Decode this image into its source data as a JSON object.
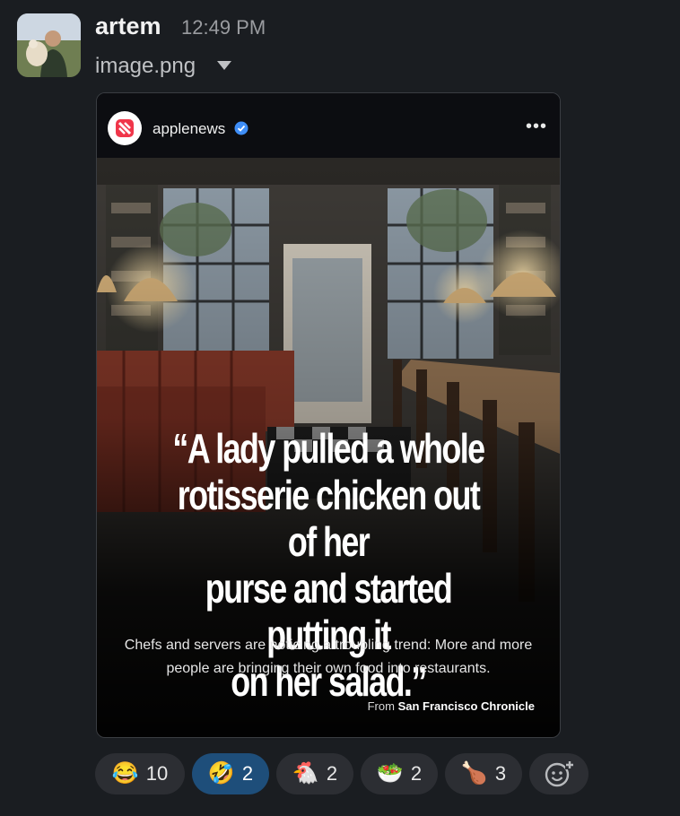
{
  "message": {
    "username": "artem",
    "timestamp": "12:49 PM",
    "filename": "image.png"
  },
  "post": {
    "account": "applenews",
    "headline": "“A lady pulled a whole\nrotisserie chicken out of her\npurse and started putting it\non her salad.”",
    "subtitle": "Chefs and servers are noticing a troubling trend: More and more people are bringing their own food into restaurants.",
    "source_prefix": "From",
    "source_name": "San Francisco Chronicle"
  },
  "reactions": [
    {
      "emoji": "😂",
      "count": "10",
      "active": false,
      "icon": "joy-emoji"
    },
    {
      "emoji": "🤣",
      "count": "2",
      "active": true,
      "icon": "rofl-emoji"
    },
    {
      "emoji": "🐔",
      "count": "2",
      "active": false,
      "icon": "chicken-emoji"
    },
    {
      "emoji": "🥗",
      "count": "2",
      "active": false,
      "icon": "salad-emoji"
    },
    {
      "emoji": "🍗",
      "count": "3",
      "active": false,
      "icon": "drumstick-emoji"
    }
  ],
  "colors": {
    "active_reaction": "#1e4e7a",
    "verified": "#3f8ef7"
  }
}
